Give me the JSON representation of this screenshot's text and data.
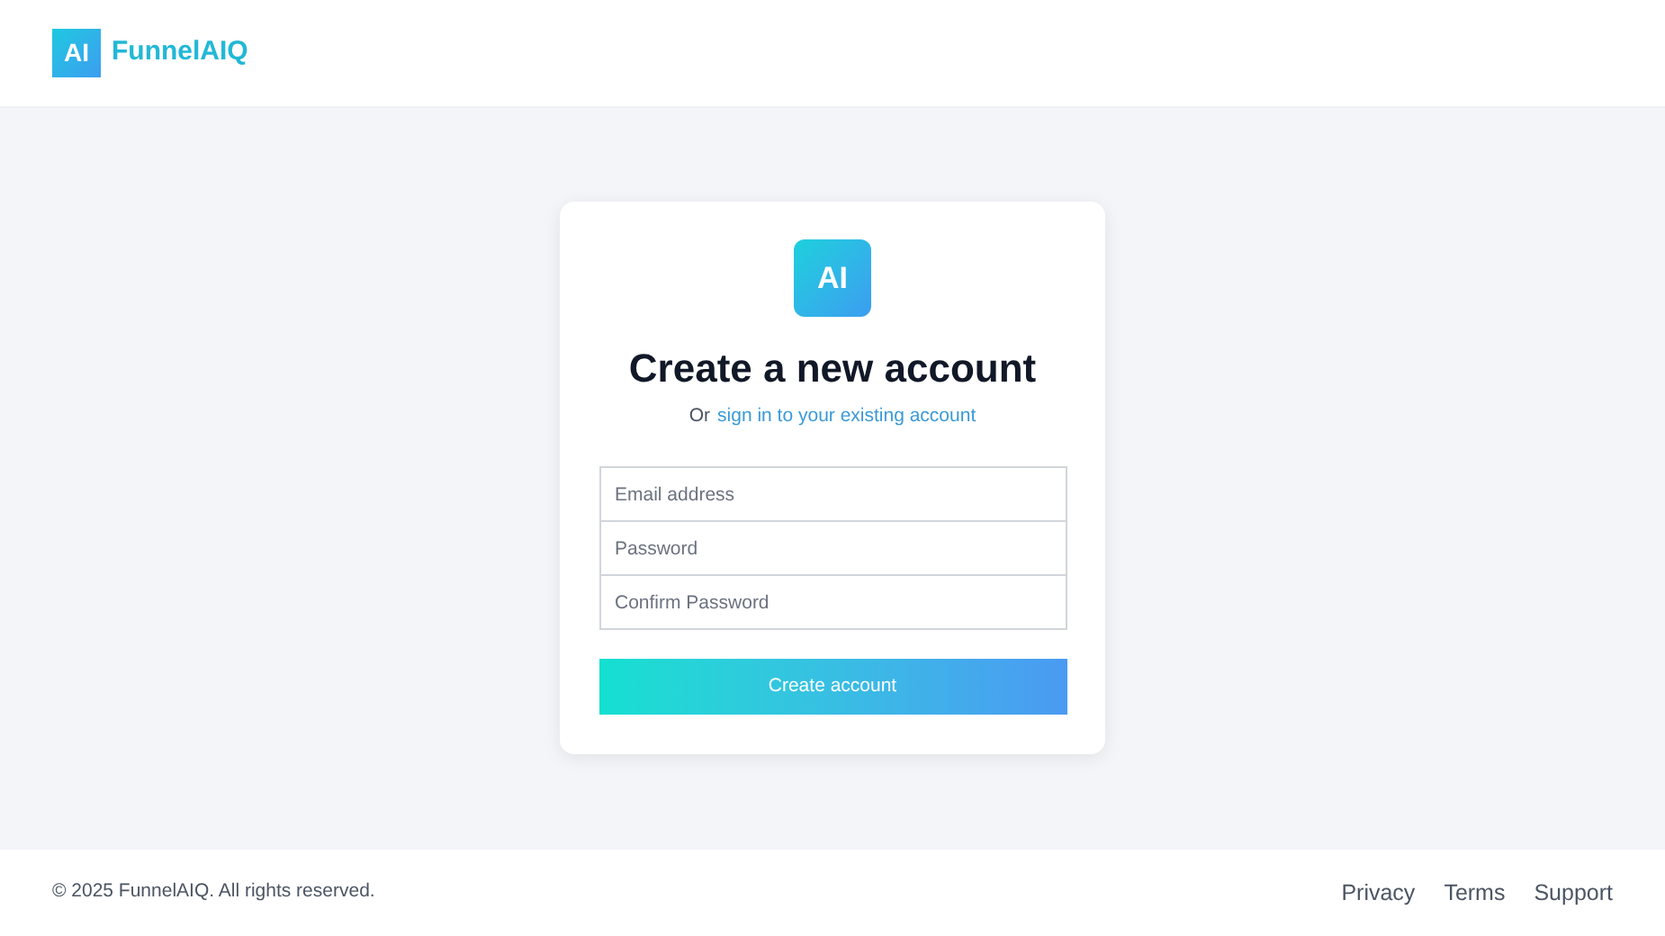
{
  "header": {
    "logo_mark": "AI",
    "brand": "FunnelAIQ"
  },
  "card": {
    "logo_mark": "AI",
    "title": "Create a new account",
    "subtitle_prefix": "Or",
    "subtitle_link": "sign in to your existing account",
    "fields": [
      {
        "placeholder": "Email address"
      },
      {
        "placeholder": "Password"
      },
      {
        "placeholder": "Confirm Password"
      }
    ],
    "submit": "Create account"
  },
  "footer": {
    "copyright": "© 2025 FunnelAIQ. All rights reserved.",
    "links": [
      "Privacy",
      "Terms",
      "Support"
    ]
  }
}
